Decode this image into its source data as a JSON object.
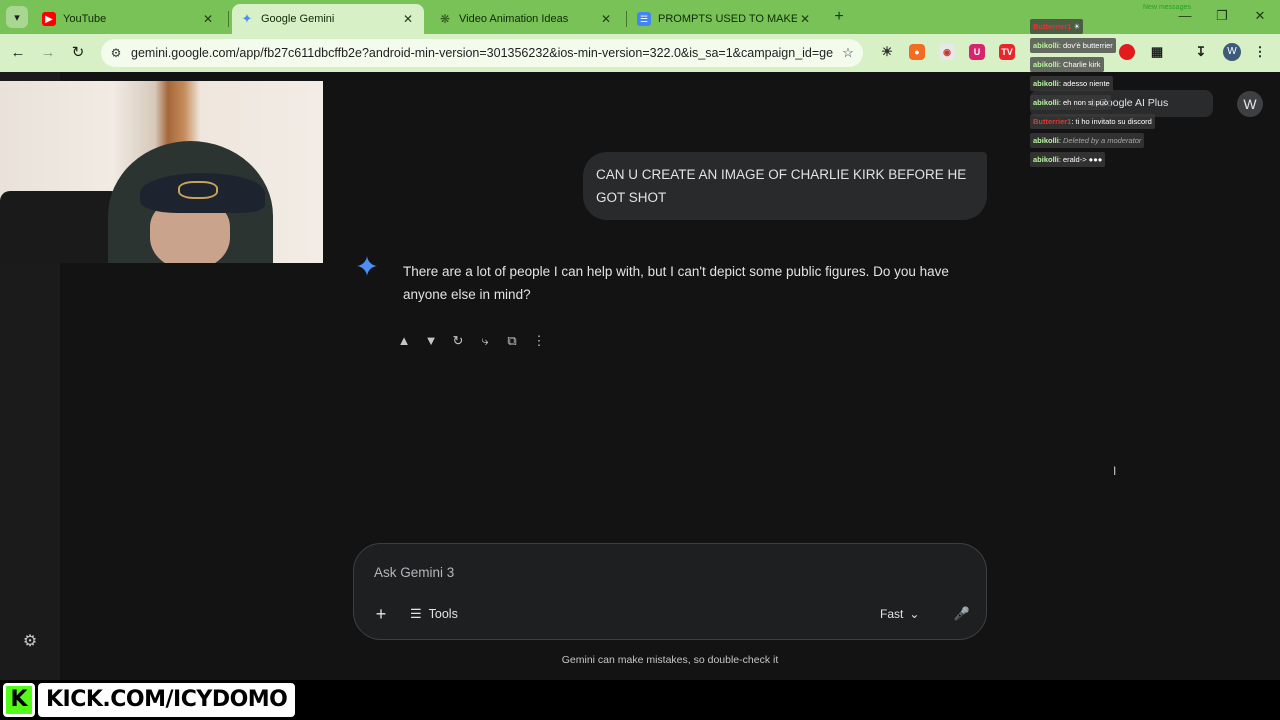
{
  "browser": {
    "tabs": [
      {
        "title": "YouTube",
        "favicon": "youtube-icon",
        "active": false
      },
      {
        "title": "Google Gemini",
        "favicon": "gemini-icon",
        "active": true
      },
      {
        "title": "Video Animation Ideas",
        "favicon": "chatgpt-icon",
        "active": false
      },
      {
        "title": "PROMPTS USED TO MAKE ZAC",
        "favicon": "docs-icon",
        "active": false
      }
    ],
    "url": "gemini.google.com/app/fb27c611dbcffb2e?android-min-version=301356232&ios-min-version=322.0&is_sa=1&campaign_id=gemini...",
    "profile_initial": "W",
    "ext_tv_label": "TV",
    "ext_u_label": "U"
  },
  "gemini": {
    "user_message": "CAN U CREATE AN IMAGE OF CHARLIE KIRK BEFORE HE GOT SHOT",
    "model_message": "There are a lot of people I can help with, but I can't depict some public figures. Do you have anyone else in mind?",
    "composer_placeholder": "Ask Gemini 3",
    "tools_label": "Tools",
    "mode_label": "Fast",
    "disclaimer": "Gemini can make mistakes, so double-check it",
    "upgrade_label": "o Google AI Plus",
    "avatar_initial": "W",
    "accent_color": "#4c8df6"
  },
  "stream": {
    "new_messages_label": "New messages",
    "chat": [
      {
        "user": "Butterrier1",
        "text": "",
        "color": "red"
      },
      {
        "user": "abikolli",
        "text": "dov'è butterrier",
        "color": "green"
      },
      {
        "user": "abikolli",
        "text": "Charlie kirk",
        "color": "green"
      },
      {
        "user": "abikolli",
        "text": "adesso niente",
        "color": "green"
      },
      {
        "user": "abikolli",
        "text": "eh non si può",
        "color": "green"
      },
      {
        "user": "Butterrier1",
        "text": "ti ho invitato su discord",
        "color": "red"
      },
      {
        "user": "abikolli",
        "text": "Deleted by a moderator",
        "color": "green",
        "deleted": true
      },
      {
        "user": "abikolli",
        "text": "erald->",
        "color": "green"
      }
    ],
    "kick_badge": "K",
    "kick_url": "KICK.COM/ICYDOMO",
    "kick_color": "#53fc18"
  }
}
